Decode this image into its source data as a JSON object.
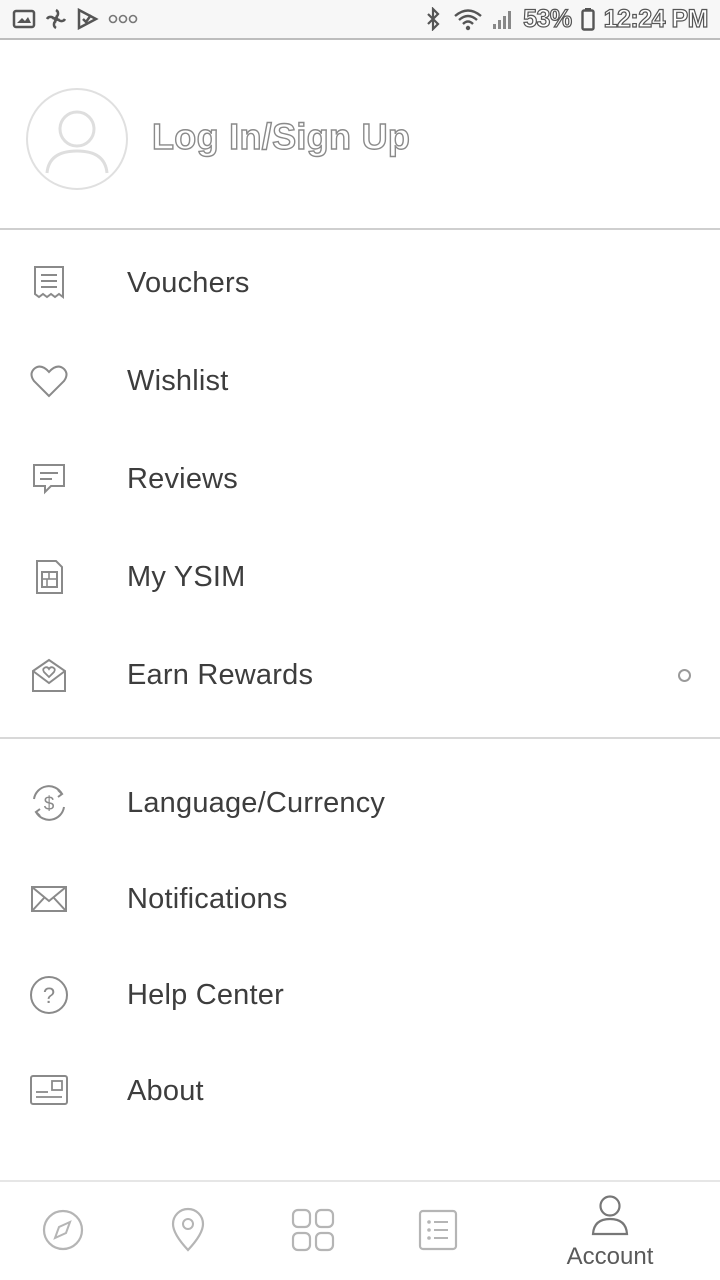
{
  "status_bar": {
    "battery": "53%",
    "time": "12:24 PM",
    "left_icons": [
      "photo-icon",
      "pinwheel-icon",
      "checkmark-app-icon",
      "more-dots-icon"
    ],
    "right_icons": [
      "bluetooth-icon",
      "wifi-icon",
      "signal-icon",
      "battery-icon"
    ]
  },
  "header": {
    "login_label": "Log In/Sign Up"
  },
  "menu_primary": [
    {
      "label": "Vouchers",
      "icon": "receipt-icon"
    },
    {
      "label": "Wishlist",
      "icon": "heart-icon"
    },
    {
      "label": "Reviews",
      "icon": "comment-icon"
    },
    {
      "label": "My YSIM",
      "icon": "sim-card-icon"
    },
    {
      "label": "Earn Rewards",
      "icon": "gift-envelope-icon"
    }
  ],
  "menu_secondary": [
    {
      "label": "Language/Currency",
      "icon": "currency-icon"
    },
    {
      "label": "Notifications",
      "icon": "envelope-icon"
    },
    {
      "label": "Help Center",
      "icon": "help-icon"
    },
    {
      "label": "About",
      "icon": "id-card-icon"
    }
  ],
  "bottom_nav": {
    "items": [
      {
        "icon": "compass-icon",
        "label": ""
      },
      {
        "icon": "location-pin-icon",
        "label": ""
      },
      {
        "icon": "grid-icon",
        "label": ""
      },
      {
        "icon": "list-icon",
        "label": ""
      },
      {
        "icon": "person-icon",
        "label": "Account"
      }
    ]
  },
  "colors": {
    "icon_gray": "#8a8a8a",
    "text_dark": "#3d3d3d",
    "divider": "#d8d8d8"
  }
}
